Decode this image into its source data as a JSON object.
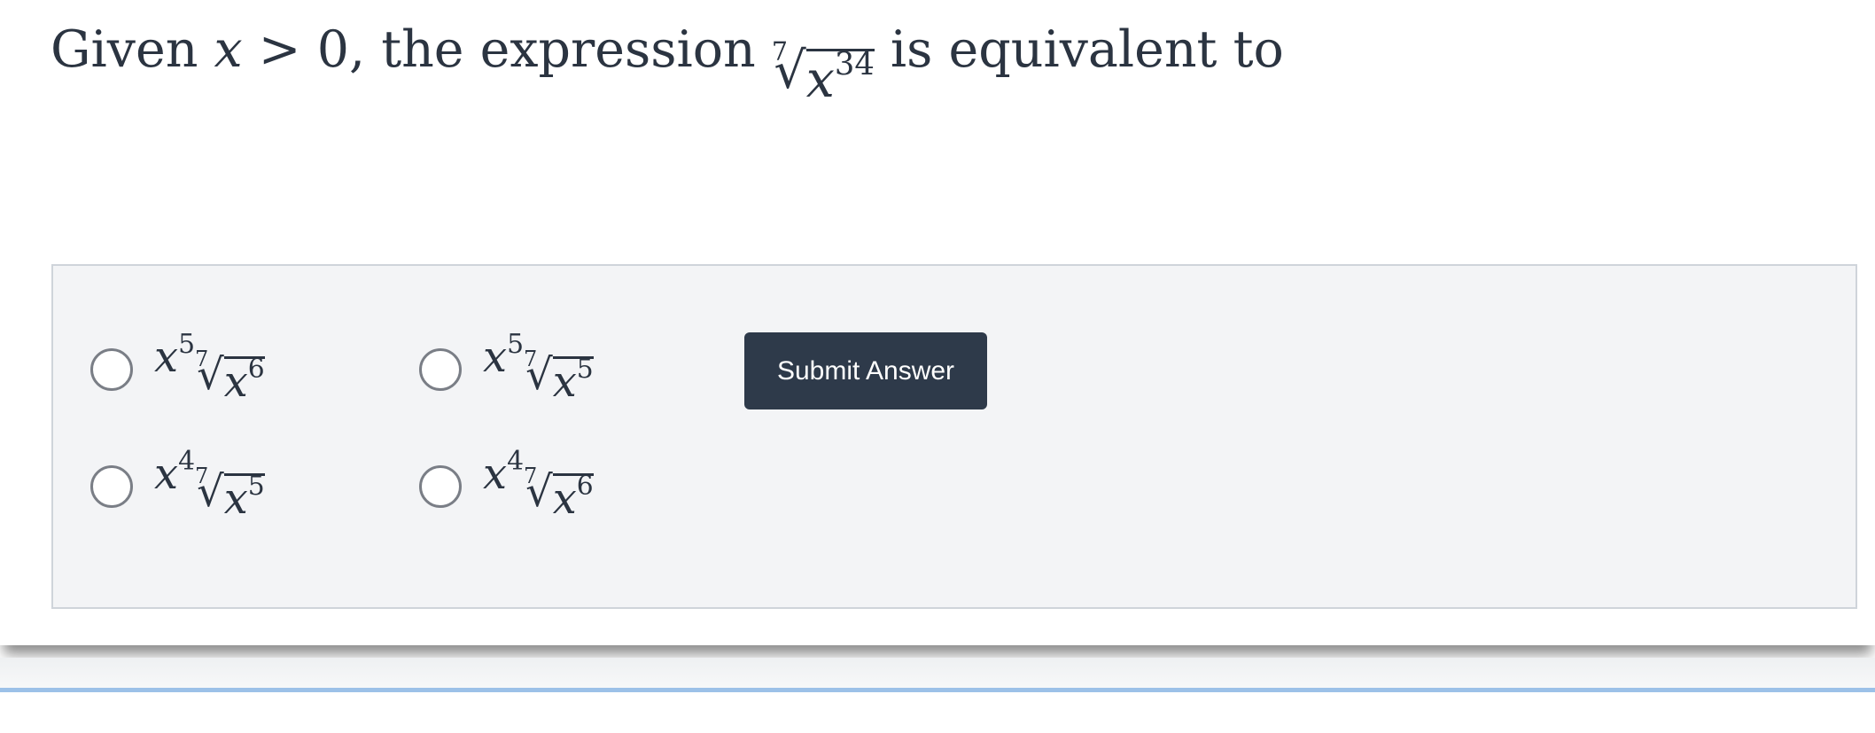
{
  "question": {
    "lead": "Given ",
    "variable": "x",
    "relation": " > ",
    "zero": "0",
    "middle": ", the expression ",
    "root_index": "7",
    "base": "x",
    "exponent": "34",
    "tail": " is equivalent to"
  },
  "options": [
    {
      "coef_base": "x",
      "coef_exp": "5",
      "root_index": "7",
      "rad_base": "x",
      "rad_exp": "6"
    },
    {
      "coef_base": "x",
      "coef_exp": "5",
      "root_index": "7",
      "rad_base": "x",
      "rad_exp": "5"
    },
    {
      "coef_base": "x",
      "coef_exp": "4",
      "root_index": "7",
      "rad_base": "x",
      "rad_exp": "5"
    },
    {
      "coef_base": "x",
      "coef_exp": "4",
      "root_index": "7",
      "rad_base": "x",
      "rad_exp": "6"
    }
  ],
  "submit_label": "Submit Answer",
  "radical_symbol": "√",
  "colors": {
    "text": "#2b3441",
    "button_bg": "#2e3a4a",
    "button_text": "#ffffff",
    "panel_bg": "#f3f4f6",
    "panel_border": "#cfd4da",
    "bottom_line": "#9cc1e8"
  }
}
